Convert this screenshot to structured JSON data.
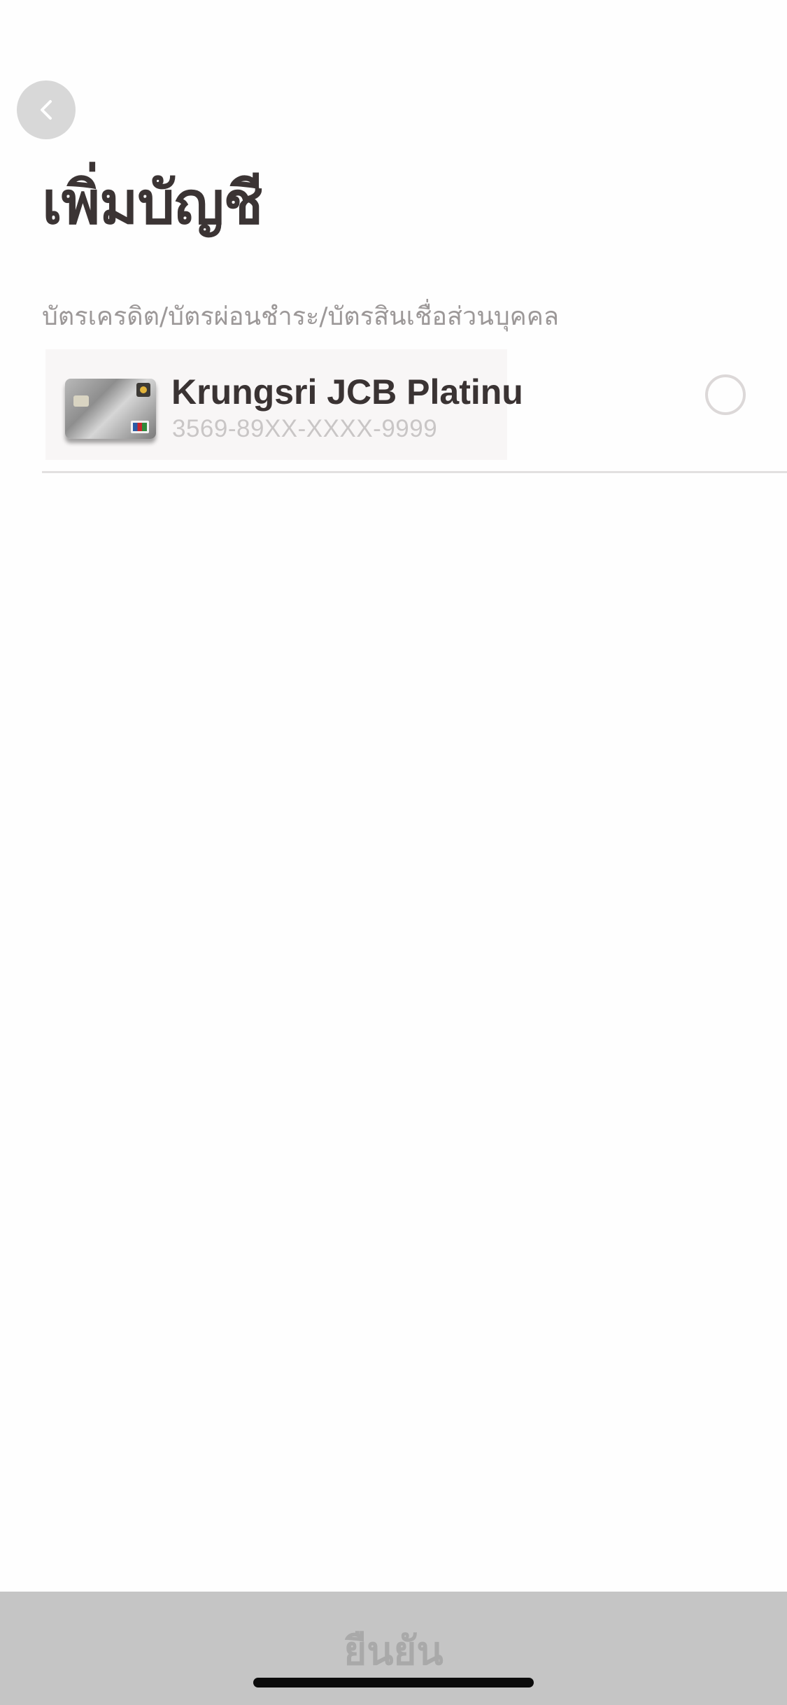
{
  "header": {
    "back_icon": "chevron-left-icon",
    "title": "เพิ่มบัญชี"
  },
  "section": {
    "label": "บัตรเครดิต/บัตรผ่อนชำระ/บัตรสินเชื่อส่วนบุคคล"
  },
  "accounts": [
    {
      "card_image": "krungsri-jcb-platinum-card-icon",
      "name": "Krungsri JCB Platinu",
      "number": "3569-89XX-XXXX-9999",
      "selected": false
    }
  ],
  "footer": {
    "confirm_label": "ยืนยัน",
    "enabled": false
  },
  "colors": {
    "title_text": "#3b3434",
    "secondary_text": "#9c9898",
    "card_number_text": "#c9c6c6",
    "footer_background": "#c5c5c5",
    "footer_text_disabled": "#a9a9a9",
    "back_button_background": "#d8d8d8"
  }
}
